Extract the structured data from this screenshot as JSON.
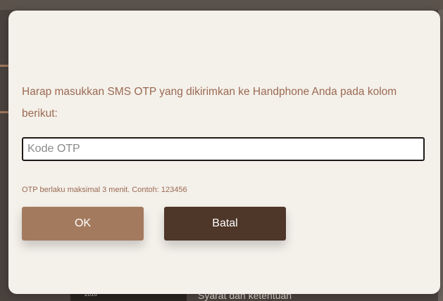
{
  "dialog": {
    "prompt": "Harap masukkan SMS OTP yang dikirimkan ke Handphone Anda pada kolom berikut:",
    "otp_input": {
      "value": "",
      "placeholder": "Kode OTP"
    },
    "hint": "OTP berlaku maksimal 3 menit. Contoh: 123456",
    "ok_label": "OK",
    "cancel_label": "Batal"
  },
  "background": {
    "footer_link": "Syarat dan ketentuan",
    "photo_label": "2016"
  },
  "colors": {
    "modal_bg": "#f4f0ea",
    "text_accent": "#9a6a52",
    "ok_button": "#a47a5e",
    "cancel_button": "#4e3628"
  }
}
